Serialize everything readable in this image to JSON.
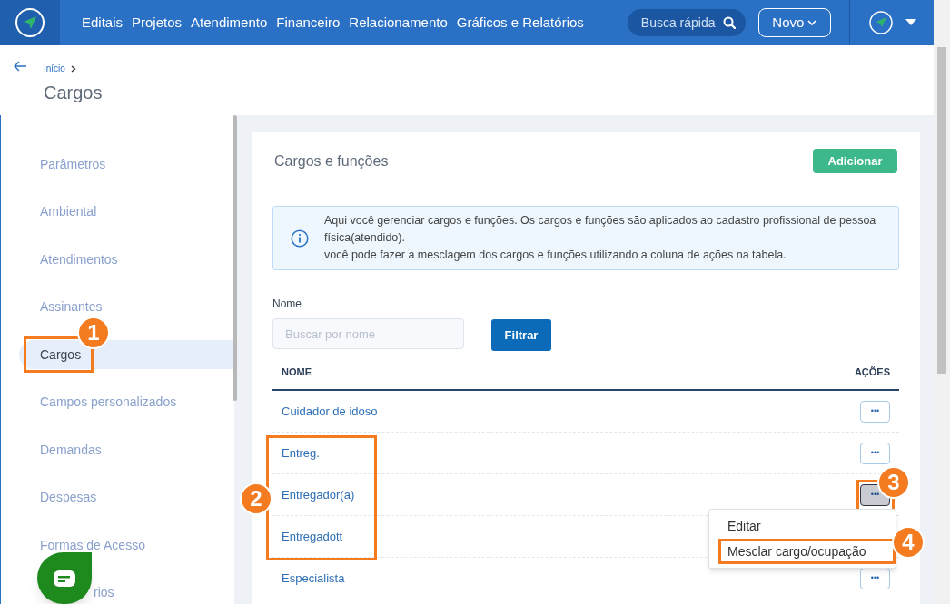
{
  "topbar": {
    "nav": [
      "Editais",
      "Projetos",
      "Atendimento",
      "Financeiro",
      "Relacionamento",
      "Gráficos e Relatórios"
    ],
    "search": {
      "placeholder": "Busca rápida"
    },
    "new_button": "Novo"
  },
  "header": {
    "breadcrumb": "Início",
    "title": "Cargos"
  },
  "sidebar": {
    "items": [
      {
        "label": "Parâmetros",
        "selected": false
      },
      {
        "label": "Ambiental",
        "selected": false
      },
      {
        "label": "Atendimentos",
        "selected": false
      },
      {
        "label": "Assinantes",
        "selected": false
      },
      {
        "label": "Cargos",
        "selected": true,
        "callout": "1"
      },
      {
        "label": "Campos personalizados",
        "selected": false
      },
      {
        "label": "Demandas",
        "selected": false
      },
      {
        "label": "Despesas",
        "selected": false
      },
      {
        "label": "Formas de Acesso",
        "selected": false
      },
      {
        "label": "rios",
        "selected": false,
        "covered": true
      }
    ]
  },
  "card": {
    "title": "Cargos e funções",
    "add_button": "Adicionar",
    "info": "Aqui você gerenciar cargos e funções. Os cargos e funções são aplicados ao cadastro profissional de pessoa física(atendido).\nvocê pode fazer a mesclagem dos cargos e funções utilizando a coluna de ações na tabela.",
    "filter": {
      "label": "Nome",
      "placeholder": "Buscar por nome",
      "button": "Filtrar"
    },
    "table": {
      "columns": [
        "NOME",
        "AÇÕES"
      ],
      "callout": "2",
      "rows": [
        {
          "name": "Cuidador de idoso",
          "actions": "•••",
          "selected": false,
          "marked": false
        },
        {
          "name": "Entreg.",
          "actions": "•••",
          "selected": false,
          "marked": true
        },
        {
          "name": "Entregador(a)",
          "actions": "•••",
          "selected": true,
          "marked": true,
          "callout": "3"
        },
        {
          "name": "Entregadott",
          "selected": false,
          "marked": true
        },
        {
          "name": "Especialista",
          "actions": "•••",
          "selected": false,
          "marked": false
        }
      ]
    },
    "menu": {
      "items": [
        {
          "label": "Editar"
        },
        {
          "label": "Mesclar cargo/ocupação",
          "callout": "4"
        }
      ]
    }
  }
}
